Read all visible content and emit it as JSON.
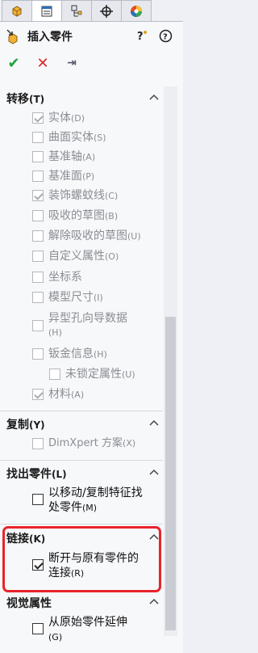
{
  "tabs": [
    {
      "icon": "feature-manager-icon"
    },
    {
      "icon": "property-manager-icon"
    },
    {
      "icon": "configuration-manager-icon"
    },
    {
      "icon": "dimxpert-manager-icon"
    },
    {
      "icon": "display-manager-icon"
    }
  ],
  "header": {
    "title": "插入零件",
    "icons": [
      "insert-part-icon",
      "whats-wrong-help-icon",
      "help-icon"
    ],
    "actions": {
      "ok": "✔",
      "cancel": "✕",
      "pin": "⇥"
    }
  },
  "sections": {
    "transfer": {
      "title": "转移",
      "key": "(T)",
      "items": [
        {
          "label": "实体",
          "key": "(D)",
          "checked": true
        },
        {
          "label": "曲面实体",
          "key": "(S)",
          "checked": false
        },
        {
          "label": "基准轴",
          "key": "(A)",
          "checked": false
        },
        {
          "label": "基准面",
          "key": "(P)",
          "checked": false
        },
        {
          "label": "装饰螺蚊线",
          "key": "(C)",
          "checked": true
        },
        {
          "label": "吸收的草图",
          "key": "(B)",
          "checked": false
        },
        {
          "label": "解除吸收的草图",
          "key": "(U)",
          "checked": false
        },
        {
          "label": "自定义属性",
          "key": "(O)",
          "checked": false
        },
        {
          "label": "坐标系",
          "key": "",
          "checked": false
        },
        {
          "label": "模型尺寸",
          "key": "(I)",
          "checked": false
        },
        {
          "label": "异型孔向导数据",
          "key": "(H)",
          "checked": false
        },
        {
          "label": "钣金信息",
          "key": "(H)",
          "checked": false
        },
        {
          "label": "未锁定属性",
          "key": "(U)",
          "checked": false
        },
        {
          "label": "材料",
          "key": "(A)",
          "checked": true
        }
      ]
    },
    "copy": {
      "title": "复制",
      "key": "(Y)",
      "item": {
        "label": "DimXpert 方案",
        "key": "(X)",
        "checked": false
      }
    },
    "find_parts": {
      "title": "找出零件",
      "key": "(L)",
      "item": {
        "label_line1": "以移动/复制特征找",
        "label_line2": "处零件",
        "key": "(M)",
        "checked": false
      }
    },
    "link": {
      "title": "链接",
      "key": "(K)",
      "item": {
        "label_line1": "断开与原有零件的",
        "label_line2": "连接",
        "key": "(R)",
        "checked": true
      }
    },
    "visual": {
      "title": "视觉属性",
      "item": {
        "label_line1": "从原始零件延伸",
        "key": "(G)",
        "checked": false
      }
    }
  },
  "colors": {
    "highlight": "#e8232b",
    "ok": "#22a23c",
    "cancel": "#d9252c"
  }
}
